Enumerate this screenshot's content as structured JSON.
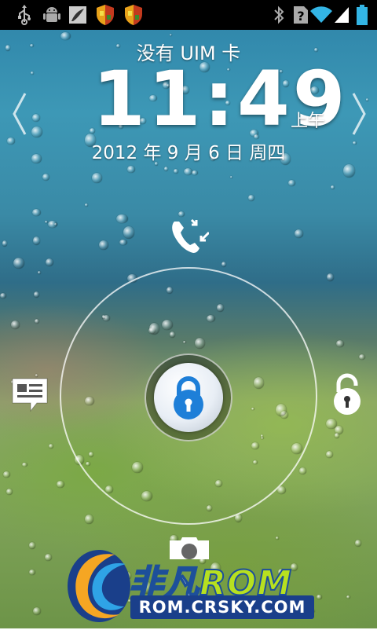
{
  "statusbar": {
    "left_icons": [
      "usb-icon",
      "android-debug-icon",
      "file-icon",
      "shield-app-icon",
      "shield-app-icon"
    ],
    "right_icons": [
      "bluetooth-icon",
      "unknown-sim-icon",
      "wifi-icon",
      "signal-icon",
      "battery-icon"
    ],
    "help_glyph": "?"
  },
  "lockscreen": {
    "carrier": "没有 UIM 卡",
    "time": "11:49",
    "ampm": "上午",
    "date": "2012 年 9 月 6 日 周四"
  },
  "actions": {
    "top": "missed-call-icon",
    "left": "message-icon",
    "right": "unlock-icon",
    "bottom": "camera-icon",
    "center": "lock-icon"
  },
  "watermark": {
    "title_cn": "非凡",
    "title_rom": "ROM",
    "url": "ROM.CRSKY.COM"
  },
  "colors": {
    "statusbar": "#000000",
    "wifi": "#33b5e5",
    "lock_blue": "#1e7fd8",
    "watermark_blue": "#1a3f8a",
    "watermark_green": "#b7e020"
  }
}
